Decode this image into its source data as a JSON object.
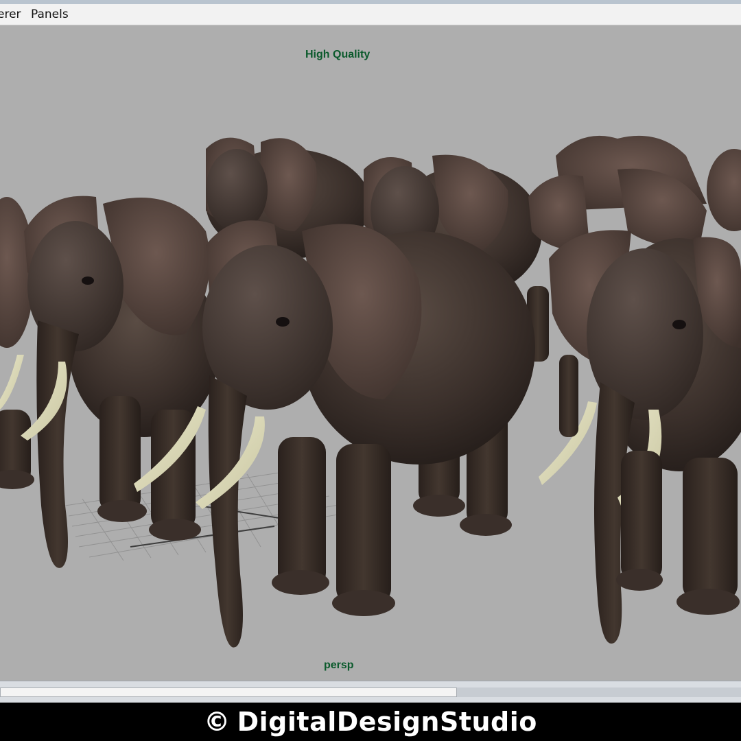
{
  "menu": {
    "items": [
      {
        "label": "erer"
      },
      {
        "label": "Panels"
      }
    ]
  },
  "viewport": {
    "hud_title": "High Quality",
    "camera_label": "persp",
    "background_color": "#aeaeae",
    "hud_text_color": "#0b5a2c",
    "content": "elephant-herd-render"
  },
  "watermark": {
    "symbol": "©",
    "text": "DigitalDesignStudio"
  }
}
